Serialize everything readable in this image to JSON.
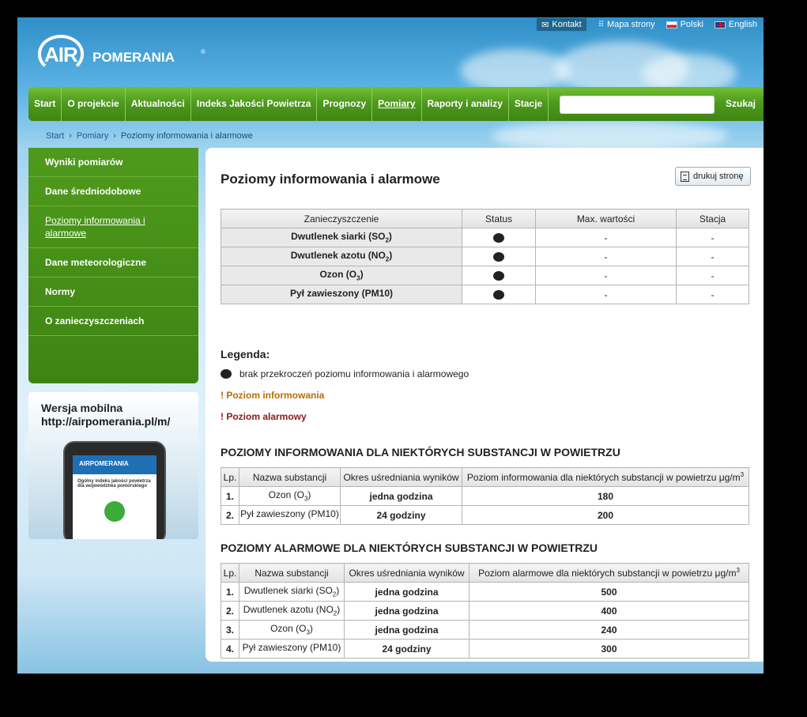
{
  "header": {
    "logo_air": "AIR",
    "logo_pomerania": "POMERANIA",
    "logo_reg": "®",
    "kontakt": "Kontakt",
    "mapa": "Mapa strony",
    "polski": "Polski",
    "english": "English"
  },
  "nav": {
    "items": [
      "Start",
      "O projekcie",
      "Aktualności",
      "Indeks Jakości Powietrza",
      "Prognozy",
      "Pomiary",
      "Raporty i analizy",
      "Stacje"
    ],
    "search_value": "",
    "search_label": "Szukaj"
  },
  "breadcrumb": {
    "start": "Start",
    "sep": "›",
    "pomiary": "Pomiary",
    "current": "Poziomy informowania i alarmowe"
  },
  "sidebar": {
    "items": [
      "Wyniki pomiarów",
      "Dane średniodobowe",
      "Poziomy informowania i alarmowe",
      "Dane meteorologiczne",
      "Normy",
      "O zanieczyszczeniach"
    ],
    "mobile_title": "Wersja mobilna",
    "mobile_url": "http://airpomerania.pl/m/",
    "phone_title": "AIRPOMERANIA",
    "phone_text": "Ogólny indeks jakości powietrza dla województwa pomorskiego"
  },
  "content": {
    "title": "Poziomy informowania i alarmowe",
    "print_label": "drukuj stronę",
    "status_table": {
      "headers": [
        "Zanieczyszczenie",
        "Status",
        "Max. wartości",
        "Stacja"
      ],
      "rows": [
        {
          "name": "Dwutlenek siarki (SO",
          "sub": "2",
          "close": ")",
          "max": "-",
          "station": "-"
        },
        {
          "name": "Dwutlenek azotu (NO",
          "sub": "2",
          "close": ")",
          "max": "-",
          "station": "-"
        },
        {
          "name": "Ozon (O",
          "sub": "3",
          "close": ")",
          "max": "-",
          "station": "-"
        },
        {
          "name": "Pył zawieszony (PM10)",
          "sub": "",
          "close": "",
          "max": "-",
          "station": "-"
        }
      ]
    },
    "legend": {
      "title": "Legenda:",
      "none": "brak przekroczeń poziomu informowania i alarmowego",
      "info": "! Poziom informowania",
      "alarm": "! Poziom alarmowy"
    },
    "info_section": {
      "title": "POZIOMY INFORMOWANIA DLA NIEKTÓRYCH SUBSTANCJI W POWIETRZU",
      "headers": [
        "Lp.",
        "Nazwa substancji",
        "Okres uśredniania wyników",
        "Poziom informowania dla niektórych substancji w powietrzu μg/m",
        "3"
      ],
      "rows": [
        {
          "lp": "1.",
          "name": "Ozon (O",
          "sub": "3",
          "close": ")",
          "period": "jedna godzina",
          "value": "180"
        },
        {
          "lp": "2.",
          "name": "Pył zawieszony (PM10)",
          "sub": "",
          "close": "",
          "period": "24 godziny",
          "value": "200"
        }
      ]
    },
    "alarm_section": {
      "title": "POZIOMY ALARMOWE DLA NIEKTÓRYCH SUBSTANCJI W POWIETRZU",
      "headers": [
        "Lp.",
        "Nazwa substancji",
        "Okres uśredniania wyników",
        "Poziom alarmowe dla niektórych substancji w powietrzu  μg/m",
        "3"
      ],
      "rows": [
        {
          "lp": "1.",
          "name": "Dwutlenek siarki (SO",
          "sub": "2",
          "close": ")",
          "period": "jedna godzina",
          "value": "500"
        },
        {
          "lp": "2.",
          "name": "Dwutlenek azotu (NO",
          "sub": "2",
          "close": ")",
          "period": "jedna godzina",
          "value": "400"
        },
        {
          "lp": "3.",
          "name": "Ozon (O",
          "sub": "3",
          "close": ")",
          "period": "jedna godzina",
          "value": "240"
        },
        {
          "lp": "4.",
          "name": "Pył zawieszony (PM10)",
          "sub": "",
          "close": "",
          "period": "24 godziny",
          "value": "300"
        }
      ]
    }
  }
}
